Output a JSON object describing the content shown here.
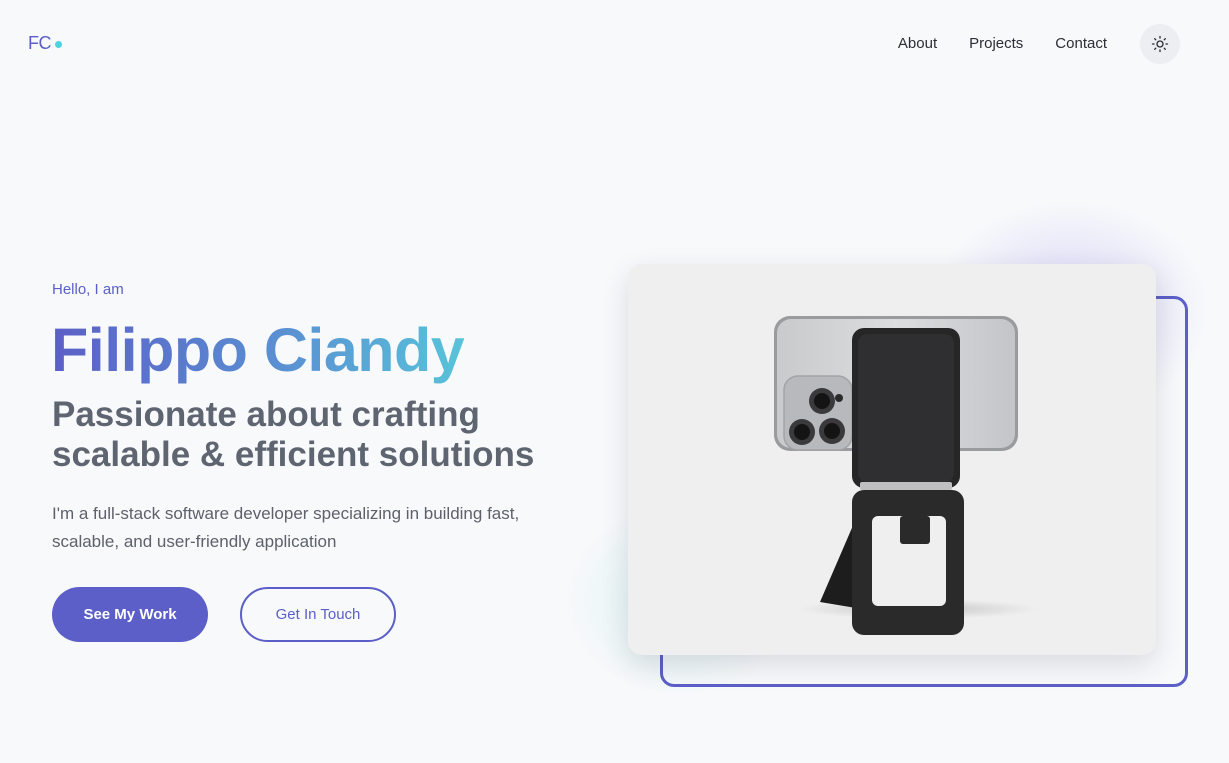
{
  "header": {
    "logo": "FC",
    "nav": [
      "About",
      "Projects",
      "Contact"
    ],
    "theme_toggle_icon": "sun-icon"
  },
  "hero": {
    "greeting": "Hello, I am",
    "name": "Filippo Ciandy",
    "tagline": "Passionate about crafting scalable & efficient solutions",
    "description": "I'm a full-stack software developer specializing in building fast, scalable, and user-friendly application",
    "primary_button": "See My Work",
    "secondary_button": "Get In Touch"
  },
  "colors": {
    "accent": "#5b5fc7",
    "accent_teal": "#58c3d9",
    "background": "#f8f9fb"
  }
}
